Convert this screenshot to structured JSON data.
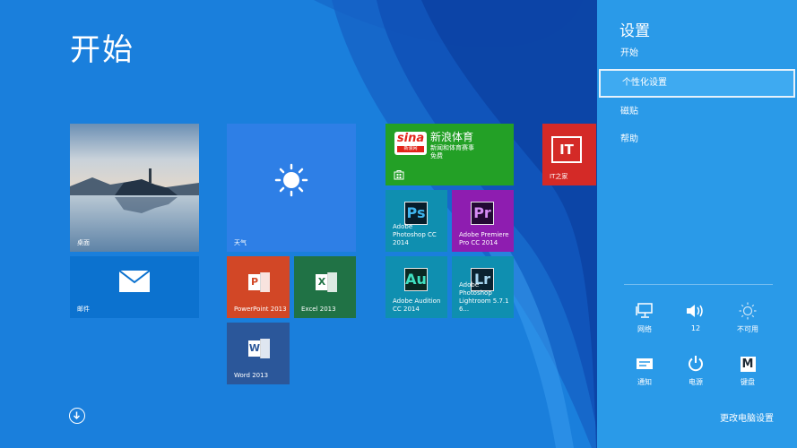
{
  "start": {
    "title": "开始"
  },
  "tiles": {
    "desktop": {
      "label": "桌面"
    },
    "mail": {
      "label": "邮件"
    },
    "weather": {
      "label": "天气"
    },
    "sina": {
      "logo": "sina",
      "logo_sub": "新浪网",
      "title": "新浪体育",
      "subtitle": "新闻和体育赛事",
      "price": "免费"
    },
    "ithome": {
      "label": "IT之家",
      "logo": "IT"
    },
    "photoshop": {
      "label": "Adobe Photoshop CC 2014",
      "icon": "Ps"
    },
    "premiere": {
      "label": "Adobe Premiere Pro CC 2014",
      "icon": "Pr"
    },
    "audition": {
      "label": "Adobe Audition CC 2014",
      "icon": "Au"
    },
    "lightroom": {
      "label": "Adobe Photoshop Lightroom 5.7.1 6...",
      "icon": "Lr"
    },
    "powerpoint": {
      "label": "PowerPoint 2013",
      "icon": "P"
    },
    "excel": {
      "label": "Excel 2013",
      "icon": "X"
    },
    "word": {
      "label": "Word 2013",
      "icon": "W"
    }
  },
  "settings": {
    "title": "设置",
    "items": [
      {
        "label": "开始"
      },
      {
        "label": "个性化设置"
      },
      {
        "label": "磁贴"
      },
      {
        "label": "帮助"
      }
    ],
    "quick": [
      {
        "label": "网络",
        "icon": "network-icon"
      },
      {
        "label": "12",
        "icon": "volume-icon"
      },
      {
        "label": "不可用",
        "icon": "brightness-icon"
      },
      {
        "label": "通知",
        "icon": "notifications-icon"
      },
      {
        "label": "电源",
        "icon": "power-icon"
      },
      {
        "label": "键盘",
        "icon": "keyboard-icon",
        "glyph": "M"
      }
    ],
    "change_pc_settings": "更改电脑设置"
  },
  "colors": {
    "background": "#1a7fdc",
    "panel": "#2a9ae8",
    "weather": "#2e7fe6",
    "sina": "#23a026",
    "ithome": "#d42a27",
    "adobe_teal": "#0f8fb0",
    "premiere": "#8e1db0",
    "powerpoint": "#d24726",
    "excel": "#207245",
    "word": "#2b579a"
  }
}
